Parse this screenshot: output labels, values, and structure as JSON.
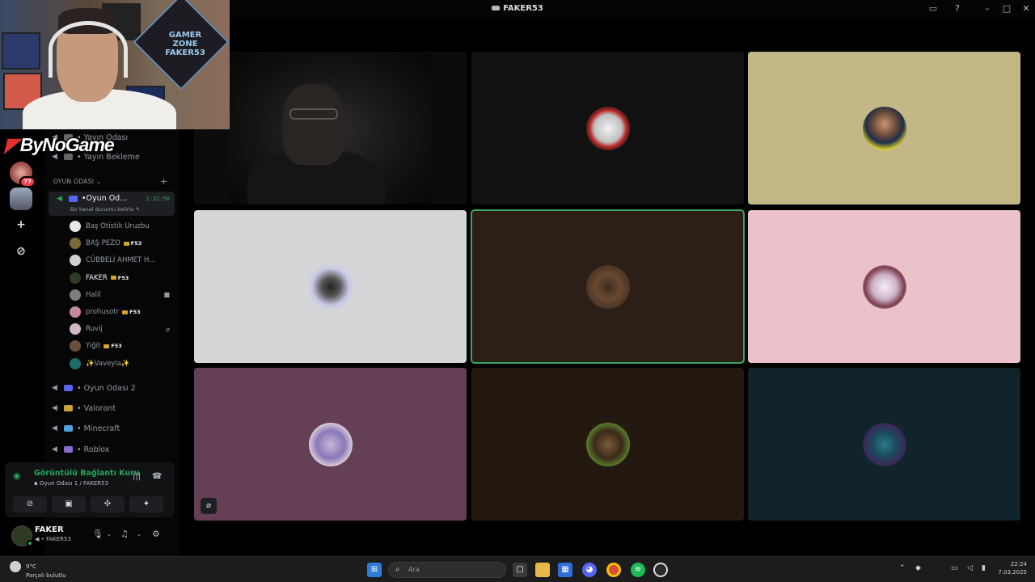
{
  "window": {
    "title": "FAKER53"
  },
  "logo": {
    "text": "ByNoGame"
  },
  "rail": {
    "badge": "77",
    "add": "+",
    "explore": "⊘"
  },
  "sidebar": {
    "top_channels": [
      {
        "label": "Yayın Odası"
      },
      {
        "label": "Yayın Bekleme"
      }
    ],
    "category": "OYUN ODASI",
    "active_channel": {
      "label": "Oyun Od...",
      "time": "1:32:50",
      "status": "Bir kanal durumu belirle"
    },
    "members": [
      {
        "name": "Baş Otistik Uruzbu",
        "tag": "",
        "color": "#e6e6e6"
      },
      {
        "name": "BAŞ PEZO",
        "tag": "F53",
        "color": "#7a6a3a"
      },
      {
        "name": "CÜBBELİ AHMET H...",
        "tag": "",
        "color": "#cfcfcf"
      },
      {
        "name": "FAKER",
        "tag": "F53",
        "color": "#2d3a24"
      },
      {
        "name": "Halil",
        "tag": "",
        "color": "#7d7d7d"
      },
      {
        "name": "prohusotr",
        "tag": "F53",
        "color": "#c48b9c"
      },
      {
        "name": "Ruvij",
        "tag": "",
        "color": "#d1b8c6"
      },
      {
        "name": "Yiğit",
        "tag": "F53",
        "color": "#6a4f3a"
      },
      {
        "name": "✨Vaveyla✨",
        "tag": "",
        "color": "#1e6b6b"
      }
    ],
    "other_channels": [
      {
        "label": "Oyun Odası 2",
        "emo": "#5865f2"
      },
      {
        "label": "Valorant",
        "emo": "#c9a23a"
      },
      {
        "label": "Minecraft",
        "emo": "#4fa3d9"
      },
      {
        "label": "Roblox",
        "emo": "#8a6cd1"
      }
    ]
  },
  "voice": {
    "title": "Görüntülü Bağlantı Kuru",
    "subtitle": "Oyun Odası 1 / FAKER53"
  },
  "user": {
    "name": "FAKER",
    "status": "FAKER53"
  },
  "webcam": {
    "sign": "GAMER ZONE FAKER53"
  },
  "taskbar": {
    "search_placeholder": "Ara",
    "weather_temp": "9°C",
    "weather_desc": "Parçalı bulutlu",
    "time": "22:24",
    "date": "7.03.2025"
  },
  "colors": {
    "accent": "#23a55a",
    "speaking": "#3ba55d",
    "danger": "#f23f43",
    "blurple": "#5865f2"
  }
}
